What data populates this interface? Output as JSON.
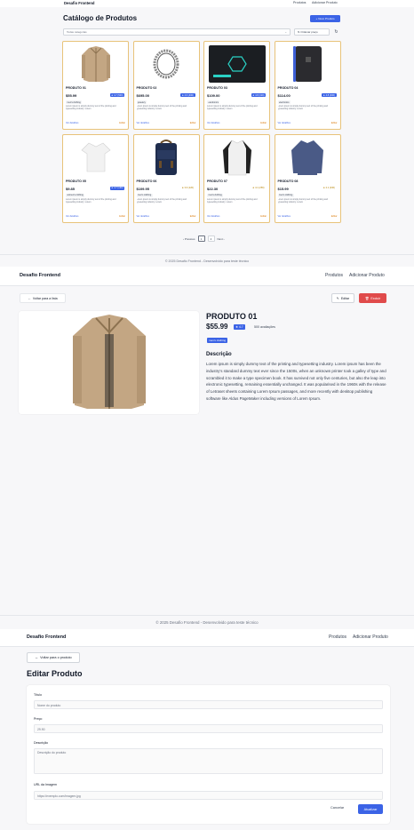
{
  "brand": "Desafio Frontend",
  "nav": {
    "products": "Produtos",
    "add_product": "Adicionar Produto"
  },
  "catalog": {
    "title": "Catálogo de Produtos",
    "new_button": "Novo Produto",
    "category_filter": "Todas categorias",
    "sort": "Ordenar preço",
    "view_label": "Ver detalhes",
    "edit_label": "Editar",
    "products": [
      {
        "name": "PRODUTO 01",
        "price": "$55.99",
        "rating": "★ 4.7 (500)",
        "category": "men's clothing",
        "desc": "Lorem ipsum is simply dummy text of the printing and typesetting industry. Lorem",
        "image": "jacket-icon",
        "rate_style": "blue"
      },
      {
        "name": "PRODUTO 02",
        "price": "$695.00",
        "rating": "★ 4.6 (400)",
        "category": "jewelery",
        "desc": "Lorem ipsum is simply dummy text of the printing and typesetting industry. Lorem",
        "image": "bracelet-icon",
        "rate_style": "blue"
      },
      {
        "name": "PRODUTO 03",
        "price": "$109.00",
        "rating": "★ 4.8 (319)",
        "category": "electronics",
        "desc": "Lorem ipsum is simply dummy text of the printing and typesetting industry. Lorem",
        "image": "ssd-icon",
        "rate_style": "blue"
      },
      {
        "name": "PRODUTO 04",
        "price": "$114.00",
        "rating": "★ 4.8 (400)",
        "category": "electronics",
        "desc": "Lorem ipsum is simply dummy text of the printing and typesetting industry. Lorem",
        "image": "hard-drive-icon",
        "rate_style": "blue"
      },
      {
        "name": "PRODUTO 05",
        "price": "$9.85",
        "rating": "★ 4.7 (130)",
        "category": "women's clothing",
        "desc": "Lorem ipsum is simply dummy text of the printing and typesetting industry. Lorem",
        "image": "tshirt-icon",
        "rate_style": "blue"
      },
      {
        "name": "PRODUTO 06",
        "price": "$109.95",
        "rating": "★ 3.9 (120)",
        "category": "men's clothing",
        "desc": "Lorem ipsum is simply dummy text of the printing and typesetting industry. Lorem",
        "image": "backpack-icon",
        "rate_style": "plain"
      },
      {
        "name": "PRODUTO 07",
        "price": "$22.30",
        "rating": "★ 4.1 (259)",
        "category": "men's clothing",
        "desc": "Lorem ipsum is simply dummy text of the printing and typesetting industry. Lorem",
        "image": "raglan-shirt-icon",
        "rate_style": "plain"
      },
      {
        "name": "PRODUTO 08",
        "price": "$15.99",
        "rating": "★ 2.1 (430)",
        "category": "men's clothing",
        "desc": "Lorem ipsum is simply dummy text of the printing and typesetting industry. Lorem",
        "image": "longsleeve-icon",
        "rate_style": "plain"
      }
    ],
    "pagination": {
      "prev": "‹ Previous",
      "pages": [
        "1",
        "2"
      ],
      "next": "Next ›"
    }
  },
  "footer": "© 2025 Desafio Frontend - Desenvolvido para teste técnico",
  "detail": {
    "back": "Voltar para a lista",
    "edit": "Editar",
    "delete": "Excluir",
    "name": "PRODUTO 01",
    "price": "$55.99",
    "rating": "★ 4.7",
    "reviews": "500 avaliações",
    "category": "men's clothing",
    "desc_heading": "Descrição",
    "description": "Lorem ipsum is simply dummy text of the printing and typesetting industry. Lorem ipsum has been the industry's standard dummy text ever since the 1500s, when an unknown printer took a galley of type and scrambled it to make a type specimen book. It has survived not only five centuries, but also the leap into electronic typesetting, remaining essentially unchanged. It was popularised in the 1960s with the release of Letraset sheets containing Lorem Ipsum passages, and more recently with desktop publishing software like Aldus PageMaker including versions of Lorem Ipsum."
  },
  "edit": {
    "back": "Voltar para o produto",
    "title": "Editar Produto",
    "fields": {
      "title_label": "Título",
      "title_placeholder": "Nome do produto",
      "price_label": "Preço",
      "price_placeholder": "29.90",
      "desc_label": "Descrição",
      "desc_placeholder": "Descrição do produto",
      "url_label": "URL da Imagem",
      "url_placeholder": "https://exemplo.com/imagem.jpg"
    },
    "cancel": "Cancelar",
    "save": "Atualizar"
  },
  "colors": {
    "accent": "#3b63e6",
    "danger": "#e04b4b",
    "card_border": "#e8c37a",
    "edit_link": "#d97706"
  }
}
